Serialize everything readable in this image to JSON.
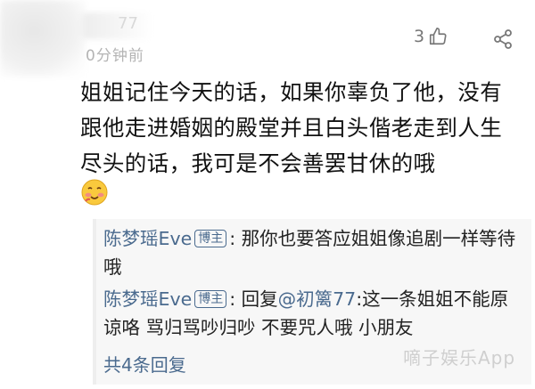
{
  "comment": {
    "username": "77",
    "time": "0分钟前",
    "like_count": "3",
    "text": "姐姐记住今天的话，如果你辜负了他，没有跟他走进婚姻的殿堂并且白头偕老走到人生尽头的话，我可是不会善罢甘休的哦",
    "emoji": "blushing-emoji"
  },
  "replies": [
    {
      "author": "陈梦瑶Eve",
      "badge": "博主",
      "separator": ": ",
      "text": "那你也要答应姐姐像追剧一样等待哦"
    },
    {
      "author": "陈梦瑶Eve",
      "badge": "博主",
      "separator": ": ",
      "prefix": "回复",
      "mention": "@初篱77",
      "text": ":这一条姐姐不能原谅咯 骂归骂吵归吵 不要咒人哦 小朋友"
    }
  ],
  "more_replies": "共4条回复",
  "watermark": "嘀子娱乐App",
  "colors": {
    "link": "#4a6a8e",
    "reply_bg": "#f7f7f7",
    "text": "#111111",
    "muted": "#b4b4b4"
  },
  "icons": {
    "like": "thumbs-up-icon",
    "share": "share-icon"
  }
}
